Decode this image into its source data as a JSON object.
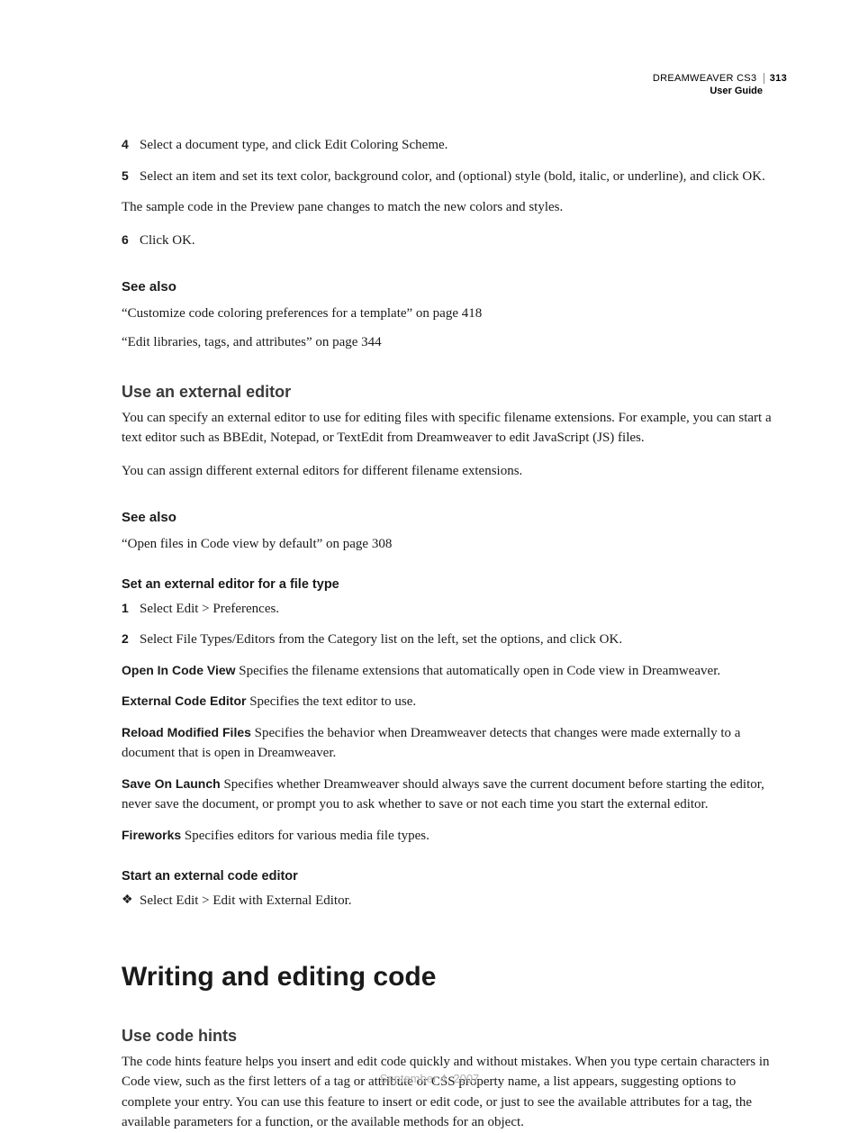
{
  "header": {
    "product": "DREAMWEAVER CS3",
    "page_number": "313",
    "guide": "User Guide"
  },
  "steps_top": [
    {
      "num": "4",
      "text": "Select a document type, and click Edit Coloring Scheme."
    },
    {
      "num": "5",
      "text": "Select an item and set its text color, background color, and (optional) style (bold, italic, or underline), and click OK."
    }
  ],
  "sample_note": "The sample code in the Preview pane changes to match the new colors and styles.",
  "steps_top2": [
    {
      "num": "6",
      "text": "Click OK."
    }
  ],
  "see_also_label": "See also",
  "see_also_1": [
    "“Customize code coloring preferences for a template” on page 418",
    "“Edit libraries, tags, and attributes” on page 344"
  ],
  "section_external": {
    "title": "Use an external editor",
    "p1": "You can specify an external editor to use for editing files with specific filename extensions. For example, you can start a text editor such as BBEdit, Notepad, or TextEdit from Dreamweaver to edit JavaScript (JS) files.",
    "p2": "You can assign different external editors for different filename extensions."
  },
  "see_also_2": [
    "“Open files in Code view by default” on page 308"
  ],
  "set_editor": {
    "title": "Set an external editor for a file type",
    "steps": [
      {
        "num": "1",
        "text": "Select Edit > Preferences."
      },
      {
        "num": "2",
        "text": "Select File Types/Editors from the Category list on the left, set the options, and click OK."
      }
    ],
    "options": [
      {
        "label": "Open In Code View",
        "text": "Specifies the filename extensions that automatically open in Code view in Dreamweaver."
      },
      {
        "label": "External Code Editor",
        "text": "Specifies the text editor to use."
      },
      {
        "label": "Reload Modified Files",
        "text": "Specifies the behavior when Dreamweaver detects that changes were made externally to a document that is open in Dreamweaver."
      },
      {
        "label": "Save On Launch",
        "text": "Specifies whether Dreamweaver should always save the current document before starting the editor, never save the document, or prompt you to ask whether to save or not each time you start the external editor."
      },
      {
        "label": "Fireworks",
        "text": "Specifies editors for various media file types."
      }
    ]
  },
  "start_editor": {
    "title": "Start an external code editor",
    "bullet": "Select Edit > Edit with External Editor."
  },
  "chapter": {
    "title": "Writing and editing code"
  },
  "code_hints": {
    "title": "Use code hints",
    "p1": "The code hints feature helps you insert and edit code quickly and without mistakes. When you type certain characters in Code view, such as the first letters of a tag or attribute or CSS property name, a list appears, suggesting options to complete your entry. You can use this feature to insert or edit code, or just to see the available attributes for a tag, the available parameters for a function, or the available methods for an object."
  },
  "footer_date": "September 4, 2007"
}
